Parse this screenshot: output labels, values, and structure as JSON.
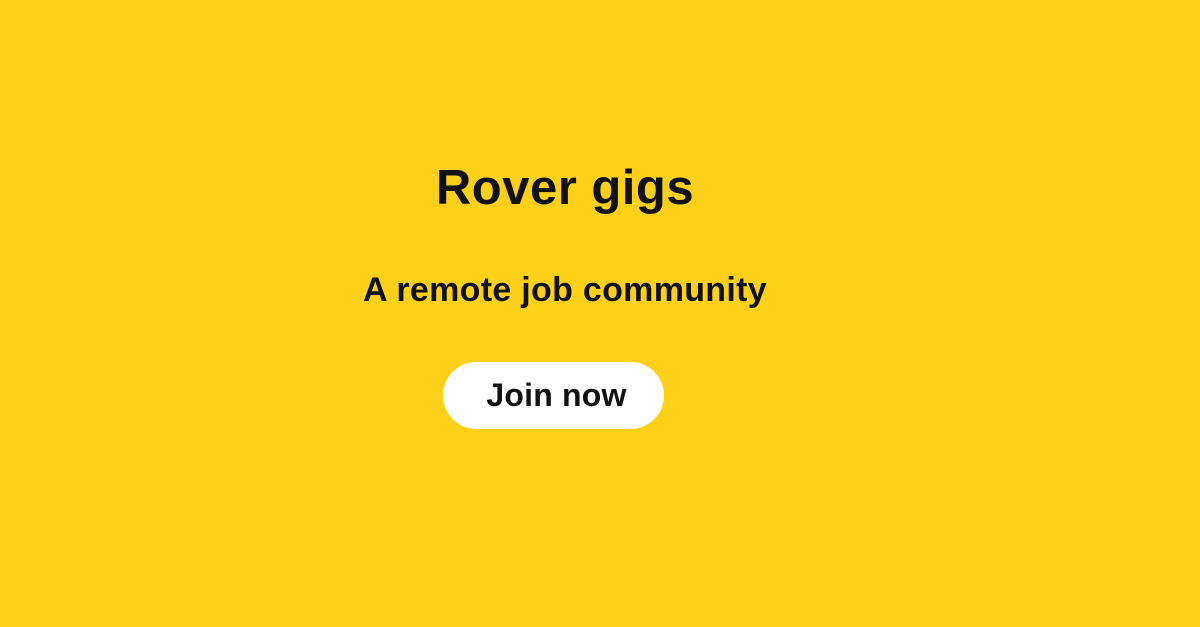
{
  "banner": {
    "title": "Rover gigs",
    "subtitle": "A remote job community",
    "cta_label": "Join now"
  },
  "colors": {
    "background": "#FED01A",
    "text": "#111111",
    "button_background": "#FFFFFF"
  }
}
